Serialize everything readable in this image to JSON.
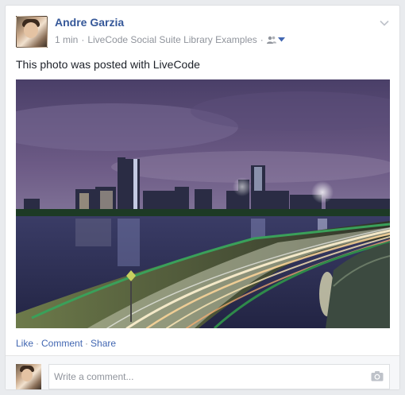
{
  "post": {
    "author": "Andre Garzia",
    "time": "1 min",
    "dot": "·",
    "source": "LiveCode Social Suite Library Examples",
    "audience_icon": "friends-icon",
    "message": "This photo was posted with LiveCode",
    "photo_description": "photo-city-skyline"
  },
  "actions": {
    "like": "Like",
    "comment": "Comment",
    "share": "Share",
    "separator": "·"
  },
  "comment_box": {
    "placeholder": "Write a comment...",
    "value": ""
  },
  "colors": {
    "link": "#365899",
    "action": "#4267b2",
    "meta": "#90949c",
    "background": "#e9ebee"
  }
}
